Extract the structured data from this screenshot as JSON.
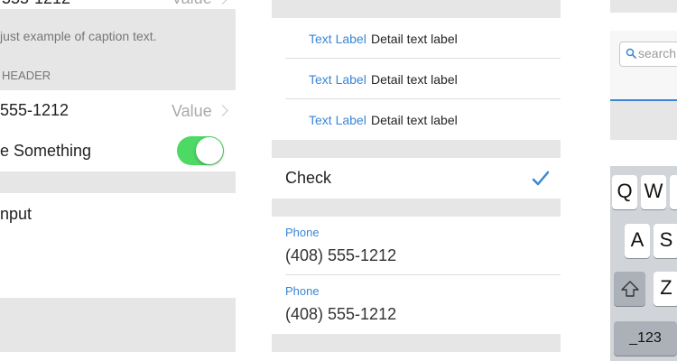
{
  "left_panel": {
    "top_row_text": "555-1212",
    "top_row_value": "Value",
    "caption": "just example of caption text.",
    "section_header": "HEADER",
    "phone_row_text": "555-1212",
    "phone_row_value": "Value",
    "toggle_label": "e Something",
    "toggle_on": true,
    "input_label": "nput"
  },
  "middle_panel": {
    "detail_rows": [
      {
        "label": "Text Label",
        "detail": "Detail text label"
      },
      {
        "label": "Text Label",
        "detail": "Detail text label"
      },
      {
        "label": "Text Label",
        "detail": "Detail text label"
      }
    ],
    "check_row": {
      "label": "Check",
      "checked": true
    },
    "phone_fields": [
      {
        "label": "Phone",
        "value": "(408) 555-1212"
      },
      {
        "label": "Phone",
        "value": "(408) 555-1212"
      }
    ]
  },
  "right_panel": {
    "search_placeholder": "search",
    "keyboard": {
      "row1": [
        "Q",
        "W"
      ],
      "row2": [
        "A",
        "S"
      ],
      "row3": [
        "Z"
      ],
      "numbers_key": "_123"
    }
  },
  "colors": {
    "accent": "#3a86d6",
    "toggle_on": "#4cd964",
    "group_background": "#e6e6e6"
  }
}
